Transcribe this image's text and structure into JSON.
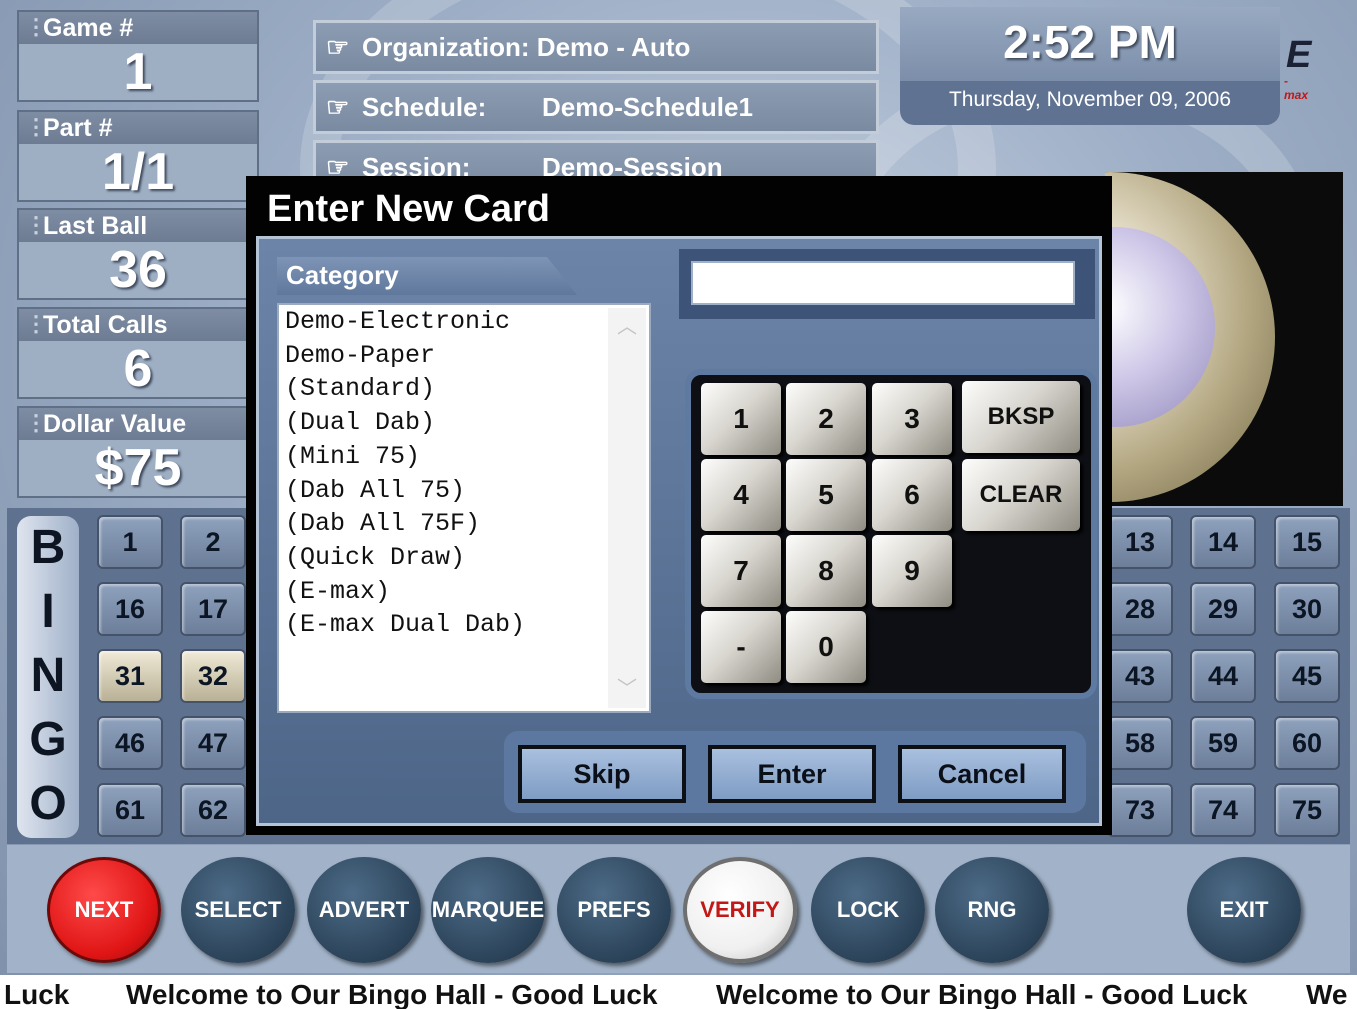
{
  "stats": [
    {
      "label": "Game #",
      "value": "1"
    },
    {
      "label": "Part #",
      "value": "1/1"
    },
    {
      "label": "Last Ball",
      "value": "36"
    },
    {
      "label": "Total Calls",
      "value": "6"
    },
    {
      "label": "Dollar Value",
      "value": "$75"
    }
  ],
  "info": {
    "organization_label": "Organization:",
    "organization_value": "Demo - Auto",
    "schedule_label": "Schedule:",
    "schedule_value": "Demo-Schedule1",
    "session_label": "Session:",
    "session_value": "Demo-Session"
  },
  "clock": {
    "time": "2:52 PM",
    "date": "Thursday, November 09, 2006"
  },
  "logo": {
    "text": "E",
    "sub": "-max"
  },
  "board": {
    "letters": [
      "B",
      "I",
      "N",
      "G",
      "O"
    ],
    "left_numbers": [
      [
        "1",
        "2"
      ],
      [
        "16",
        "17"
      ],
      [
        "31",
        "32"
      ],
      [
        "46",
        "47"
      ],
      [
        "61",
        "62"
      ]
    ],
    "right_numbers": [
      [
        "13",
        "14",
        "15"
      ],
      [
        "28",
        "29",
        "30"
      ],
      [
        "43",
        "44",
        "45"
      ],
      [
        "58",
        "59",
        "60"
      ],
      [
        "73",
        "74",
        "75"
      ]
    ],
    "called": [
      "31",
      "32"
    ]
  },
  "dialog": {
    "title": "Enter New Card",
    "category_label": "Category",
    "categories": [
      "Demo-Electronic",
      "Demo-Paper",
      "(Standard)",
      "(Dual Dab)",
      "(Mini 75)",
      "(Dab All 75)",
      "(Dab All 75F)",
      "(Quick Draw)",
      "(E-max)",
      "(E-max Dual Dab)"
    ],
    "input_value": "",
    "keys": [
      "1",
      "2",
      "3",
      "4",
      "5",
      "6",
      "7",
      "8",
      "9",
      "-",
      "0"
    ],
    "bksp": "BKSP",
    "clear": "CLEAR",
    "skip": "Skip",
    "enter": "Enter",
    "cancel": "Cancel"
  },
  "nav": [
    "NEXT",
    "SELECT",
    "ADVERT",
    "MARQUEE",
    "PREFS",
    "VERIFY",
    "LOCK",
    "RNG",
    "EXIT"
  ],
  "ticker": {
    "fragment_start": "Luck",
    "message": "Welcome to Our Bingo Hall - Good Luck",
    "fragment_end": "We"
  },
  "colors": {
    "next": "#e01515",
    "verify_text": "#c31818",
    "dialog_bg": "#020202"
  }
}
